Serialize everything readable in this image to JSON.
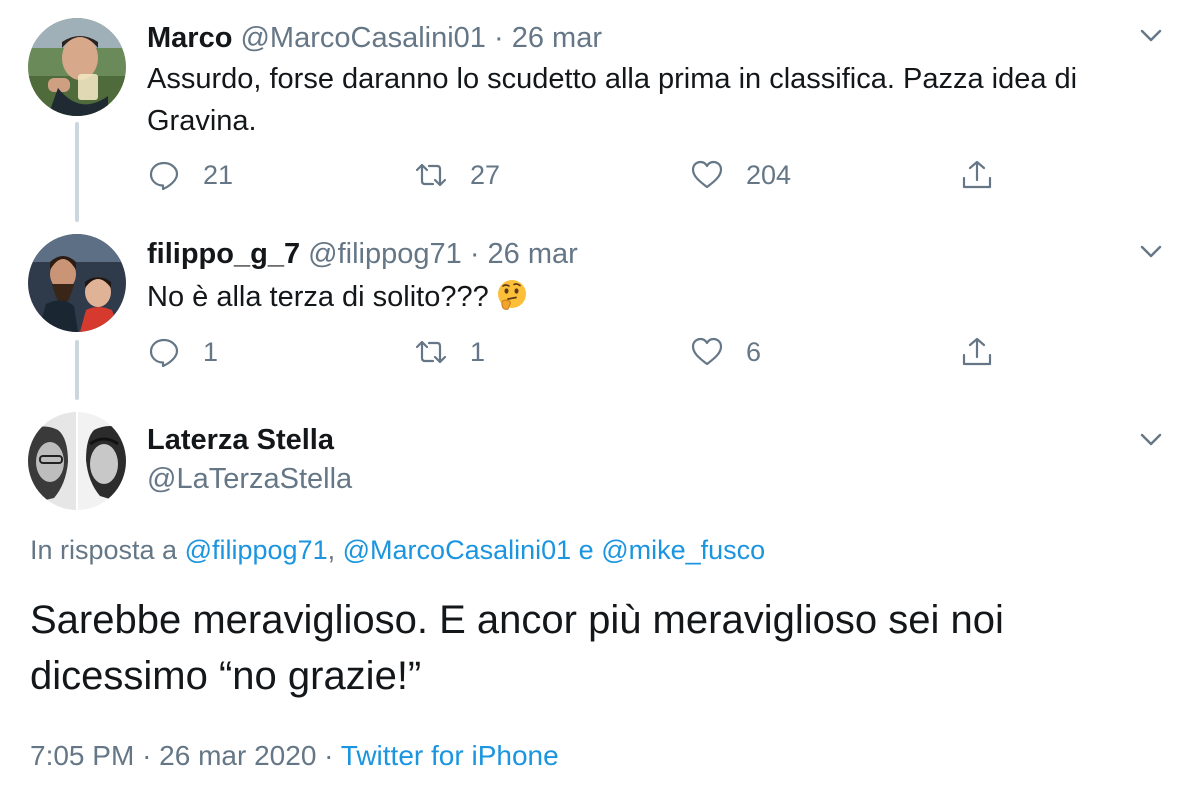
{
  "tweets": [
    {
      "display_name": "Marco",
      "handle": "@MarcoCasalini01",
      "separator": "·",
      "date": "26 mar",
      "text": "Assurdo, forse daranno lo scudetto alla prima in classifica. Pazza idea di Gravina.",
      "replies": "21",
      "retweets": "27",
      "likes": "204"
    },
    {
      "display_name": "filippo_g_7",
      "handle": "@filippog71",
      "separator": "·",
      "date": "26 mar",
      "text": "No è alla terza di solito???",
      "emoji": "thinking-face",
      "replies": "1",
      "retweets": "1",
      "likes": "6"
    }
  ],
  "main_tweet": {
    "display_name": "Laterza Stella",
    "handle": "@LaTerzaStella",
    "reply_prefix": "In risposta a",
    "reply_mentions": [
      "@filippog71",
      "@MarcoCasalini01",
      "@mike_fusco"
    ],
    "reply_separator_comma": ",",
    "reply_separator_and": "e",
    "text": "Sarebbe meraviglioso. E ancor più meraviglioso sei noi dicessimo “no grazie!”",
    "time": "7:05 PM",
    "separator": "·",
    "date": "26 mar 2020",
    "source": "Twitter for iPhone"
  },
  "icons": [
    "reply-icon",
    "retweet-icon",
    "like-icon",
    "share-icon",
    "chevron-down-icon"
  ],
  "colors": {
    "link": "#1b95e0",
    "secondary_text": "#657786",
    "primary_text": "#14171a",
    "thread_line": "#ccd6dd"
  }
}
